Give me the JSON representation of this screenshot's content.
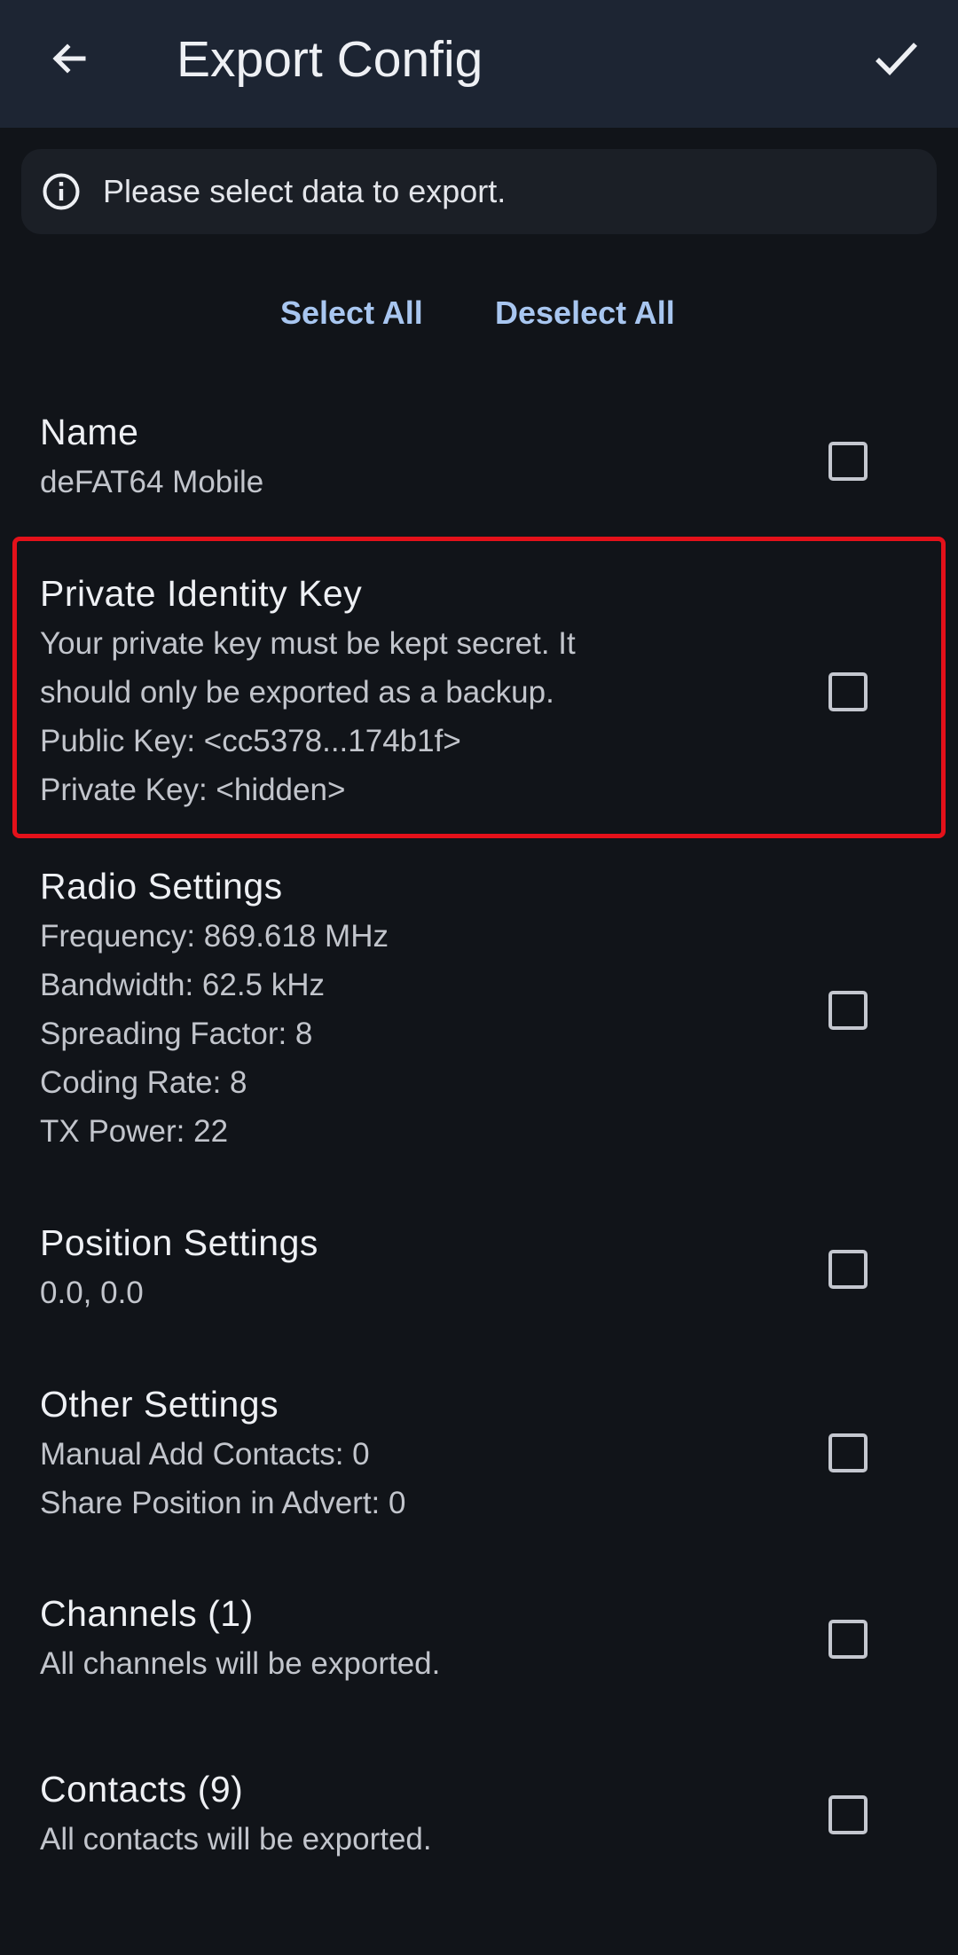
{
  "appbar": {
    "title": "Export Config",
    "back_icon": "arrow-left",
    "confirm_icon": "check"
  },
  "info": {
    "icon": "info-circle",
    "text": "Please select data to export."
  },
  "actions": {
    "select_all": "Select All",
    "deselect_all": "Deselect All"
  },
  "items": [
    {
      "title": "Name",
      "lines": [
        "deFAT64 Mobile"
      ],
      "checked": false
    },
    {
      "title": "Private Identity Key",
      "lines": [
        "Your private key must be kept secret. It",
        "should only be exported as a backup.",
        "Public Key: <cc5378...174b1f>",
        "Private Key: <hidden>"
      ],
      "checked": false,
      "highlighted": true
    },
    {
      "title": "Radio Settings",
      "lines": [
        "Frequency: 869.618 MHz",
        "Bandwidth: 62.5 kHz",
        "Spreading Factor: 8",
        "Coding Rate: 8",
        "TX Power: 22"
      ],
      "checked": false
    },
    {
      "title": "Position Settings",
      "lines": [
        "0.0, 0.0"
      ],
      "checked": false
    },
    {
      "title": "Other Settings",
      "lines": [
        "Manual Add Contacts: 0",
        "Share Position in Advert: 0"
      ],
      "checked": false
    },
    {
      "title": "Channels (1)",
      "lines": [
        "All channels will be exported."
      ],
      "checked": false
    },
    {
      "title": "Contacts (9)",
      "lines": [
        "All contacts will be exported."
      ],
      "checked": false
    }
  ],
  "colors": {
    "background": "#111419",
    "appbar": "#1d2533",
    "accent": "#a8c6f0",
    "highlight": "#e4111a"
  }
}
